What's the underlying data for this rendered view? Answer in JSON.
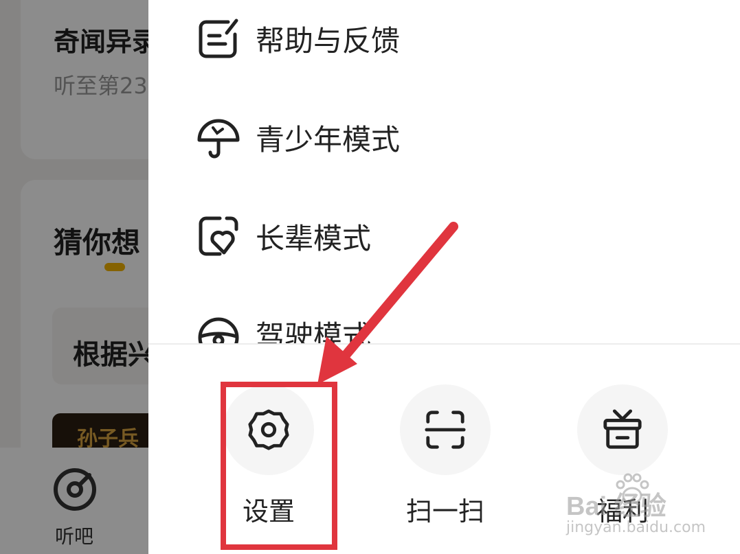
{
  "background": {
    "card_title": "奇闻异录",
    "card_subtitle": "听至第23",
    "section_title": "猜你想",
    "reason_text": "根据兴",
    "book_title": "孙子兵",
    "tab_label": "听吧"
  },
  "menu": {
    "items": [
      {
        "label": "帮助与反馈",
        "icon": "feedback-icon"
      },
      {
        "label": "青少年模式",
        "icon": "umbrella-icon"
      },
      {
        "label": "长辈模式",
        "icon": "heart-card-icon"
      },
      {
        "label": "驾驶模式",
        "icon": "steering-wheel-icon"
      }
    ]
  },
  "actions": [
    {
      "label": "设置",
      "icon": "gear-icon"
    },
    {
      "label": "扫一扫",
      "icon": "scan-icon"
    },
    {
      "label": "福利",
      "icon": "gift-icon"
    }
  ],
  "annotation": {
    "color": "#e0353e"
  },
  "watermark": {
    "logo": "Bai 经验",
    "url": "jingyan.baidu.com"
  }
}
